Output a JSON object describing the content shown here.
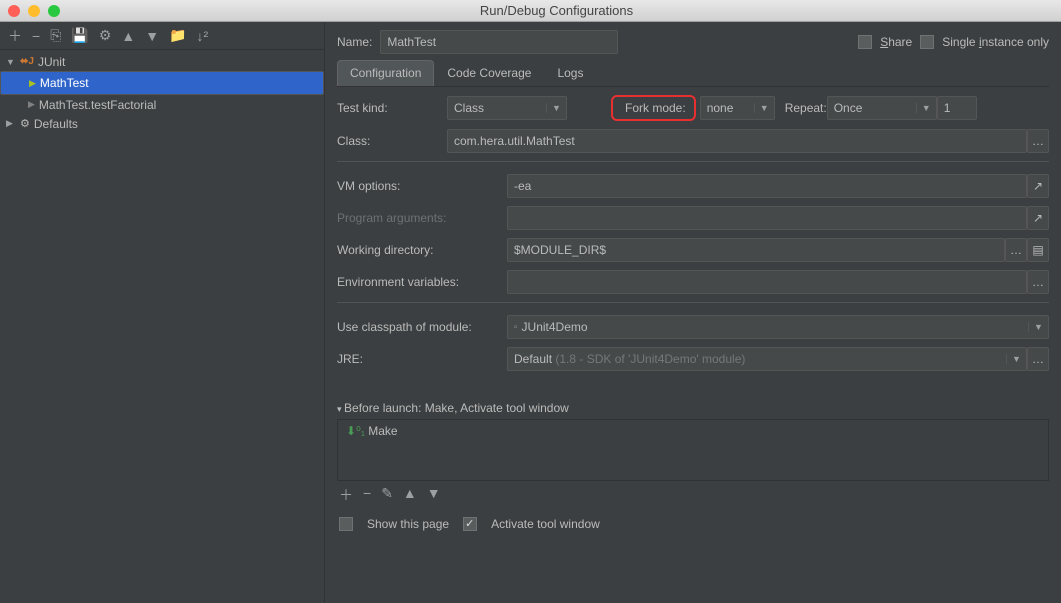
{
  "window": {
    "title": "Run/Debug Configurations"
  },
  "sidebar": {
    "items": [
      {
        "label": "JUnit",
        "expanded": true
      },
      {
        "label": "MathTest",
        "selected": true
      },
      {
        "label": "MathTest.testFactorial"
      },
      {
        "label": "Defaults",
        "expanded": false
      }
    ]
  },
  "header": {
    "name_label": "Name:",
    "name_value": "MathTest",
    "share_label": "Share",
    "single_label": "Single instance only"
  },
  "tabs": [
    {
      "label": "Configuration",
      "active": true
    },
    {
      "label": "Code Coverage"
    },
    {
      "label": "Logs"
    }
  ],
  "config": {
    "test_kind_label": "Test kind:",
    "test_kind_value": "Class",
    "fork_mode_label": "Fork mode:",
    "fork_mode_value": "none",
    "repeat_label": "Repeat:",
    "repeat_value": "Once",
    "repeat_count": "1",
    "class_label": "Class:",
    "class_value": "com.hera.util.MathTest",
    "vm_label": "VM options:",
    "vm_value": "-ea",
    "pa_label": "Program arguments:",
    "pa_value": "",
    "wd_label": "Working directory:",
    "wd_value": "$MODULE_DIR$",
    "env_label": "Environment variables:",
    "env_value": "",
    "cp_label": "Use classpath of module:",
    "cp_value": "JUnit4Demo",
    "jre_label": "JRE:",
    "jre_value": "Default",
    "jre_hint": "(1.8 - SDK of 'JUnit4Demo' module)"
  },
  "before": {
    "header": "Before launch: Make, Activate tool window",
    "items": [
      "Make"
    ]
  },
  "footer": {
    "show_page": "Show this page",
    "activate": "Activate tool window"
  }
}
